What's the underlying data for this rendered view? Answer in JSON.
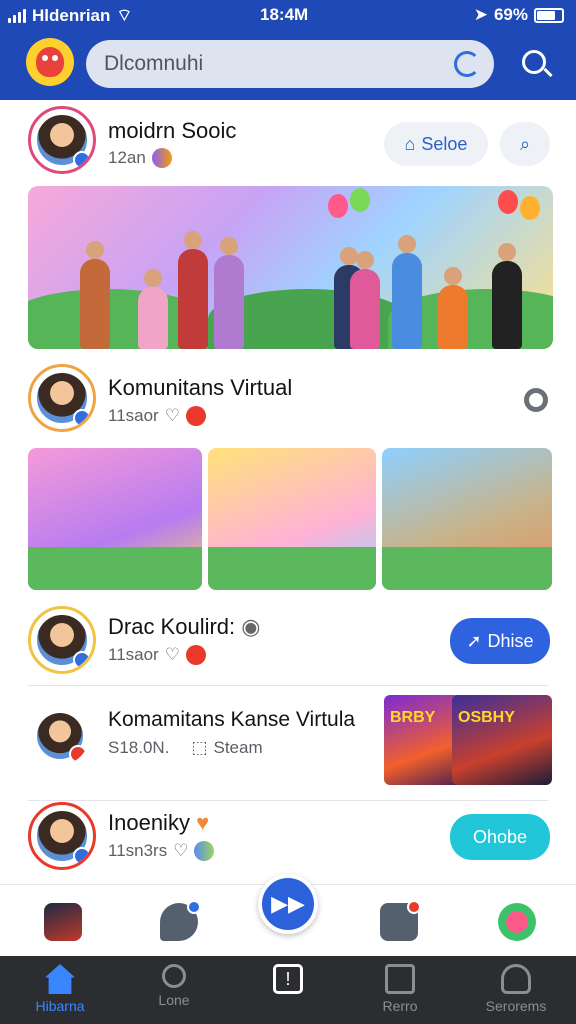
{
  "status_bar": {
    "carrier": "Hldenrian",
    "time": "18:4M",
    "battery": "69%"
  },
  "header": {
    "logo_icon": "mascot-logo-icon",
    "search_placeholder": "Dlcomnuhi",
    "search_icon": "search-icon"
  },
  "posts": [
    {
      "name": "moidrn Sooic",
      "meta": "12an",
      "buttons": {
        "primary": "Seloe"
      }
    },
    {
      "name": "Komunitans Virtual",
      "meta": "11saor"
    },
    {
      "name": "Drac Koulird:",
      "meta": "11saor",
      "buttons": {
        "primary": "Dhise"
      }
    },
    {
      "name": "Komamitans Kanse Virtula",
      "meta": "S18.0N.",
      "extra": "Steam",
      "game_label": "BRBY",
      "game_label_2": "OSBHY"
    },
    {
      "name": "Inoeniky",
      "meta": "11sn3rs",
      "buttons": {
        "primary": "Ohobe"
      }
    }
  ],
  "bottom_nav": {
    "tabs": [
      {
        "label": "Hibarna",
        "icon": "home-icon"
      },
      {
        "label": "Lone",
        "icon": "search-icon"
      },
      {
        "label": "",
        "icon": "info-card-icon"
      },
      {
        "label": "Rerro",
        "icon": "calendar-icon"
      },
      {
        "label": "Serorems",
        "icon": "profile-icon"
      }
    ]
  },
  "colors": {
    "header": "#1f49b6",
    "accent": "#2c62d9",
    "teal": "#21c7d9",
    "nav_bg": "#2b2d31"
  }
}
